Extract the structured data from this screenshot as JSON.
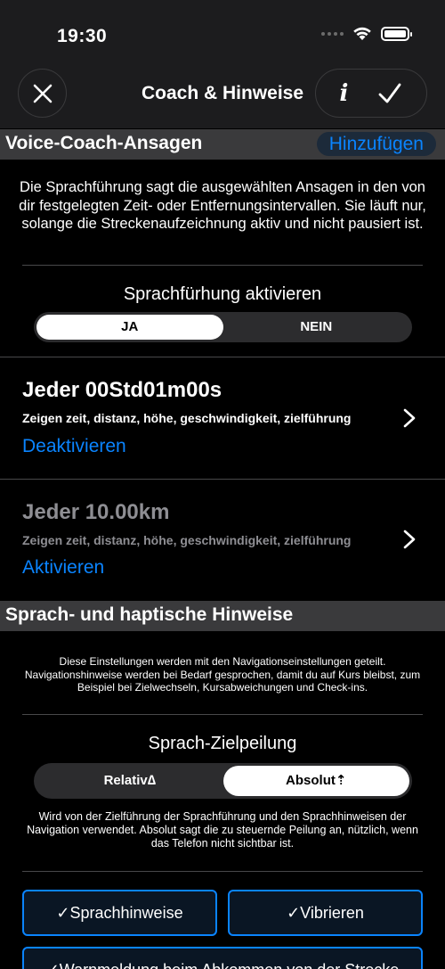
{
  "status": {
    "time": "19:30"
  },
  "nav": {
    "title": "Coach & Hinweise"
  },
  "voice_coach": {
    "header": "Voice-Coach-Ansagen",
    "add_label": "Hinzufügen",
    "description": "Die Sprachführung sagt die ausgewählten Ansagen in den von dir festgelegten Zeit- oder Entfernungsintervallen. Sie läuft nur, solange die Streckenaufzeichnung aktiv und nicht pausiert ist.",
    "activate_title": "Sprachfürhung aktivieren",
    "options": [
      "JA",
      "NEIN"
    ],
    "selected": "JA",
    "items": [
      {
        "title": "Jeder 00Std01m00s",
        "subtitle": "Zeigen zeit, distanz, höhe, geschwindigkeit, zielführung",
        "action": "Deaktivieren",
        "enabled": true
      },
      {
        "title": "Jeder 10.00km",
        "subtitle": "Zeigen zeit, distanz, höhe, geschwindigkeit, zielführung",
        "action": "Aktivieren",
        "enabled": false
      }
    ]
  },
  "hints": {
    "header": "Sprach- und haptische Hinweise",
    "description": "Diese Einstellungen werden mit den Navigationseinstellungen geteilt. Navigationshinweise werden bei Bedarf gesprochen, damit du auf Kurs bleibst, zum Beispiel bei Zielwechseln, Kursabweichungen und Check-ins.",
    "bearing_title": "Sprach-Zielpeilung",
    "bearing_options": [
      "Relativ∆",
      "Absolut⇡"
    ],
    "bearing_selected": "Absolut⇡",
    "bearing_description": "Wird von der Zielführung der Sprachführung und den Sprachhinweisen der Navigation verwendet. Absolut sagt die zu steuernde Peilung an, nützlich, wenn das Telefon nicht sichtbar ist.",
    "voice_hints_label": "✓Sprachhinweise",
    "vibrate_label": "✓Vibrieren",
    "off_route_label": "✓Warnmeldung beim Abkommen von der Strecke"
  },
  "colors": {
    "accent": "#0a84ff",
    "section_header": "#3a3a3c",
    "background": "#000000"
  }
}
